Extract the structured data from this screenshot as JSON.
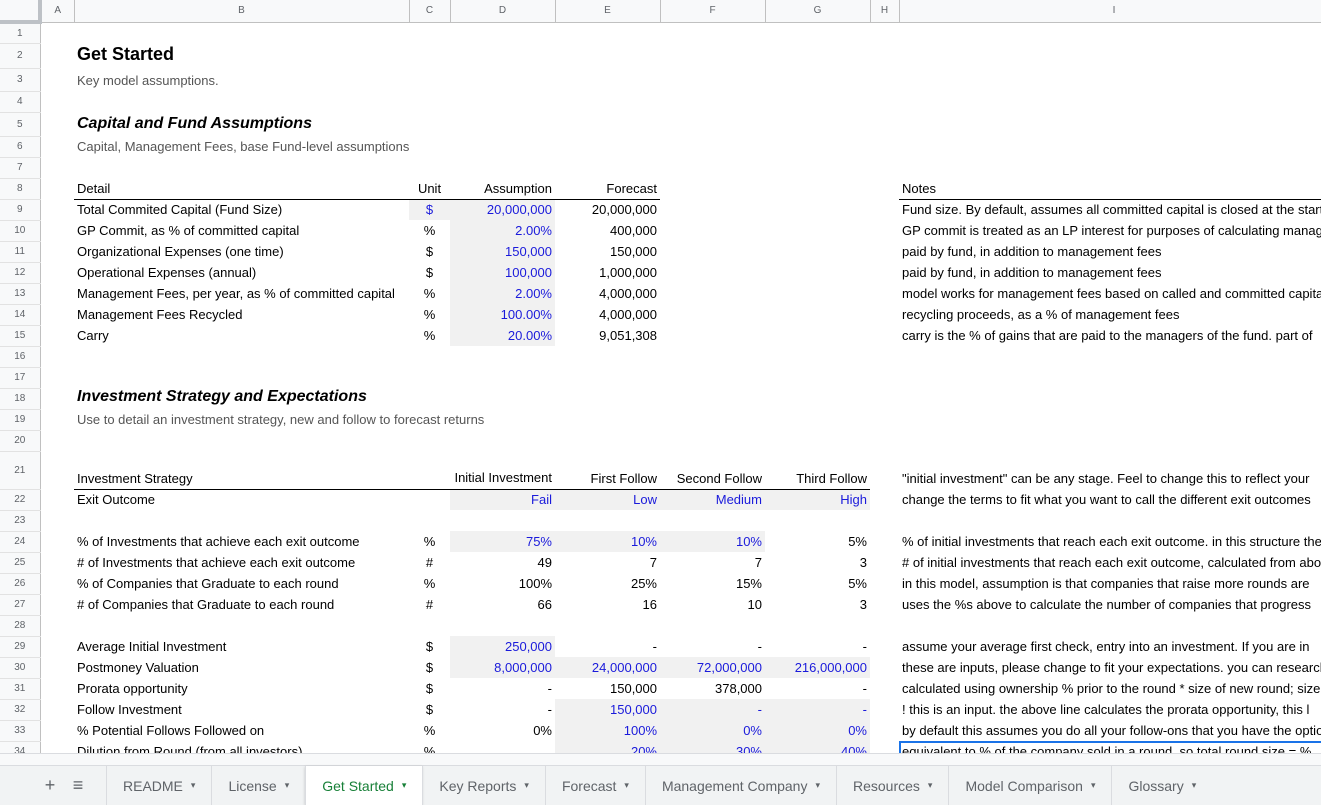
{
  "columns": [
    "A",
    "B",
    "C",
    "D",
    "E",
    "F",
    "G",
    "H",
    "I"
  ],
  "rows": [
    {
      "n": 1
    },
    {
      "n": 2,
      "B": "Get Started"
    },
    {
      "n": 3,
      "B": "Key model assumptions."
    },
    {
      "n": 4
    },
    {
      "n": 5,
      "B": "Capital and Fund Assumptions"
    },
    {
      "n": 6,
      "B": "Capital, Management Fees, base Fund-level assumptions"
    },
    {
      "n": 7
    },
    {
      "n": 8,
      "B": "Detail",
      "C": "Unit",
      "D": "Assumption",
      "E": "Forecast",
      "I": "Notes"
    },
    {
      "n": 9,
      "B": "Total Commited Capital (Fund Size)",
      "C": "$",
      "D": "20,000,000",
      "E": "20,000,000",
      "I": "Fund size. By default, assumes all committed capital is closed at the start",
      "inputs": [
        "C",
        "D"
      ]
    },
    {
      "n": 10,
      "B": "GP Commit, as % of committed capital",
      "C": "%",
      "D": "2.00%",
      "E": "400,000",
      "I": "GP commit is treated as an LP interest for purposes of calculating management fees",
      "inputs": [
        "D"
      ]
    },
    {
      "n": 11,
      "B": "Organizational Expenses (one time)",
      "C": "$",
      "D": "150,000",
      "E": "150,000",
      "I": "paid by fund, in addition to management fees",
      "inputs": [
        "D"
      ]
    },
    {
      "n": 12,
      "B": "Operational Expenses (annual)",
      "C": "$",
      "D": "100,000",
      "E": "1,000,000",
      "I": "paid by fund, in addition to management fees",
      "inputs": [
        "D"
      ]
    },
    {
      "n": 13,
      "B": "Management Fees, per year, as % of committed capital",
      "C": "%",
      "D": "2.00%",
      "E": "4,000,000",
      "I": "model works for management fees based on called and committed capital",
      "inputs": [
        "D"
      ]
    },
    {
      "n": 14,
      "B": "Management Fees Recycled",
      "C": "%",
      "D": "100.00%",
      "E": "4,000,000",
      "I": "recycling proceeds, as a % of management fees",
      "inputs": [
        "D"
      ]
    },
    {
      "n": 15,
      "B": "Carry",
      "C": "%",
      "D": "20.00%",
      "E": "9,051,308",
      "I": "carry is the % of gains that are paid to the managers of the fund. part of",
      "inputs": [
        "D"
      ]
    },
    {
      "n": 16
    },
    {
      "n": 17
    },
    {
      "n": 18,
      "B": "Investment Strategy and Expectations"
    },
    {
      "n": 19,
      "B": "Use to detail an investment strategy, new and follow to forecast returns"
    },
    {
      "n": 20
    },
    {
      "n": 21,
      "B": "Investment Strategy",
      "D": "Initial Investment",
      "E": "First Follow",
      "F": "Second Follow",
      "G": "Third Follow",
      "I": "\"initial investment\" can be any stage. Feel to change this to reflect your"
    },
    {
      "n": 22,
      "B": "Exit Outcome",
      "D": "Fail",
      "E": "Low",
      "F": "Medium",
      "G": "High",
      "I": "change the terms to fit what you want to call the different exit outcomes",
      "inputs": [
        "D",
        "E",
        "F",
        "G"
      ]
    },
    {
      "n": 23
    },
    {
      "n": 24,
      "B": "% of Investments that achieve each exit outcome",
      "C": "%",
      "D": "75%",
      "E": "10%",
      "F": "10%",
      "G": "5%",
      "I": "% of initial investments that reach each exit outcome. in this structure the",
      "inputs": [
        "D",
        "E",
        "F"
      ]
    },
    {
      "n": 25,
      "B": "# of Investments that achieve each exit outcome",
      "C": "#",
      "D": "49",
      "E": "7",
      "F": "7",
      "G": "3",
      "I": "# of initial investments that reach each exit outcome, calculated from above"
    },
    {
      "n": 26,
      "B": "% of Companies that Graduate to each round",
      "C": "%",
      "D": "100%",
      "E": "25%",
      "F": "15%",
      "G": "5%",
      "I": "in this model, assumption is that companies that raise more rounds are"
    },
    {
      "n": 27,
      "B": "# of Companies that Graduate to each round",
      "C": "#",
      "D": "66",
      "E": "16",
      "F": "10",
      "G": "3",
      "I": "uses the %s above to calculate the number of companies that progress"
    },
    {
      "n": 28
    },
    {
      "n": 29,
      "B": "Average Initial Investment",
      "C": "$",
      "D": "250,000",
      "E": "-",
      "F": "-",
      "G": "-",
      "I": "assume your average first check, entry into an investment. If you are in",
      "inputs": [
        "D"
      ]
    },
    {
      "n": 30,
      "B": "Postmoney Valuation",
      "C": "$",
      "D": "8,000,000",
      "E": "24,000,000",
      "F": "72,000,000",
      "G": "216,000,000",
      "I": "these are inputs, please change to fit your expectations. you can research",
      "inputs": [
        "D",
        "E",
        "F",
        "G"
      ]
    },
    {
      "n": 31,
      "B": "Prorata opportunity",
      "C": "$",
      "D": "-",
      "E": "150,000",
      "F": "378,000",
      "G": "-",
      "I": "calculated using ownership % prior to the round * size of new round; size"
    },
    {
      "n": 32,
      "B": "Follow Investment",
      "C": "$",
      "D": "-",
      "E": "150,000",
      "F": "-",
      "G": "-",
      "I": "! this is an input. the above line calculates the prorata opportunity, this l",
      "inputs": [
        "E",
        "F",
        "G"
      ]
    },
    {
      "n": 33,
      "B": "% Potential Follows Followed on",
      "C": "%",
      "D": "0%",
      "E": "100%",
      "F": "0%",
      "G": "0%",
      "I": "by default this assumes you do all your follow-ons that you have the option",
      "inputs": [
        "E",
        "F",
        "G"
      ]
    },
    {
      "n": 34,
      "B": "Dilution from Round (from all investors)",
      "C": "%",
      "E": "20%",
      "F": "30%",
      "G": "40%",
      "I": "equivalent to % of the company sold in a round, so total round size = %",
      "inputs": [
        "E",
        "F",
        "G"
      ],
      "selected": "I"
    }
  ],
  "tabs": {
    "add_icon": "+",
    "menu_icon": "≡",
    "items": [
      {
        "label": "README"
      },
      {
        "label": "License"
      },
      {
        "label": "Get Started",
        "active": true
      },
      {
        "label": "Key Reports"
      },
      {
        "label": "Forecast"
      },
      {
        "label": "Management Company"
      },
      {
        "label": "Resources"
      },
      {
        "label": "Model Comparison"
      },
      {
        "label": "Glossary"
      }
    ],
    "dropdown_icon": "▾"
  },
  "colors": {
    "input_text": "#1a1adb",
    "input_bg": "#f1f1f1",
    "active_tab": "#188038",
    "selection": "#1a73e8"
  }
}
